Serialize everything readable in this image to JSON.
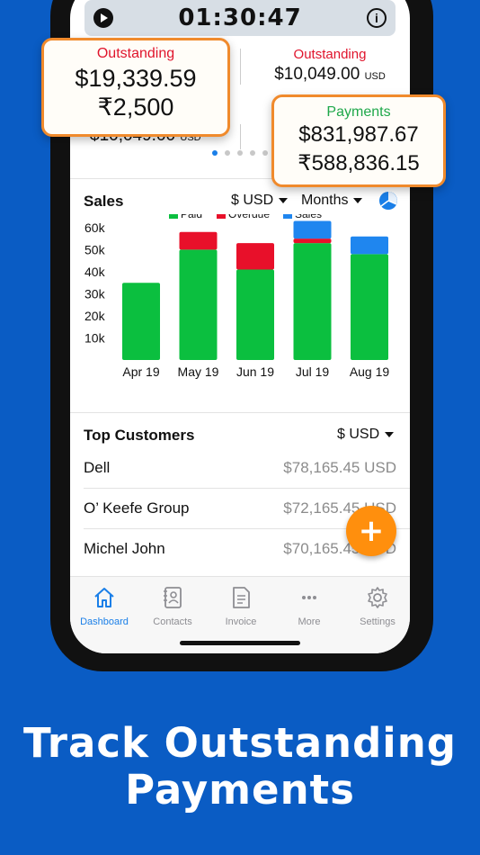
{
  "timer": {
    "value": "01:30:47"
  },
  "summary": {
    "outstanding_label": "Outstanding",
    "outstanding_right_value": "$10,049.00",
    "outstanding_right_unit": "USD",
    "bottom_left_value": "$10,049.00",
    "bottom_left_unit": "USD"
  },
  "callouts": {
    "outstanding": {
      "label": "Outstanding",
      "line1": "$19,339.59",
      "line2": "₹2,500"
    },
    "payments": {
      "label": "Payments",
      "line1": "$831,987.67",
      "line2": "₹588,836.15"
    }
  },
  "sales": {
    "title": "Sales",
    "currency": "$ USD",
    "period": "Months",
    "icon": "pie-chart-icon"
  },
  "chart_data": {
    "type": "bar",
    "stacked": true,
    "categories": [
      "Apr 19",
      "May 19",
      "Jun 19",
      "Jul 19",
      "Aug 19"
    ],
    "series": [
      {
        "name": "Paid",
        "color": "#0bbf3f",
        "values": [
          35000,
          50000,
          41000,
          53000,
          48000
        ]
      },
      {
        "name": "Overdue",
        "color": "#e8102a",
        "values": [
          0,
          8000,
          12000,
          2000,
          0
        ]
      },
      {
        "name": "Sales",
        "color": "#1f86ef",
        "values": [
          0,
          0,
          0,
          8000,
          8000
        ]
      }
    ],
    "y_ticks": [
      "10k",
      "20k",
      "30k",
      "40k",
      "50k",
      "60k"
    ],
    "ylim": [
      0,
      62000
    ],
    "legend_position": "top-center"
  },
  "top_customers": {
    "title": "Top Customers",
    "currency": "$ USD",
    "rows": [
      {
        "name": "Dell",
        "amount": "$78,165.45 USD"
      },
      {
        "name": "O’ Keefe Group",
        "amount": "$72,165.45 USD"
      },
      {
        "name": "Michel John",
        "amount": "$70,165.45 USD"
      }
    ]
  },
  "fab": {
    "label": "+"
  },
  "tabs": [
    {
      "label": "Dashboard",
      "icon": "home-icon",
      "active": true
    },
    {
      "label": "Contacts",
      "icon": "contacts-book-icon"
    },
    {
      "label": "Invoice",
      "icon": "invoice-document-icon"
    },
    {
      "label": "More",
      "icon": "more-dots-icon"
    },
    {
      "label": "Settings",
      "icon": "gear-icon"
    }
  ],
  "headline": {
    "line1": "Track Outstanding",
    "line2": "Payments"
  },
  "colors": {
    "background": "#0a5cc4",
    "accent": "#1a7fe8",
    "callout_border": "#f08a2c",
    "fab": "#ff8f0d",
    "outstanding": "#e0142c",
    "payments": "#1fa84a"
  }
}
